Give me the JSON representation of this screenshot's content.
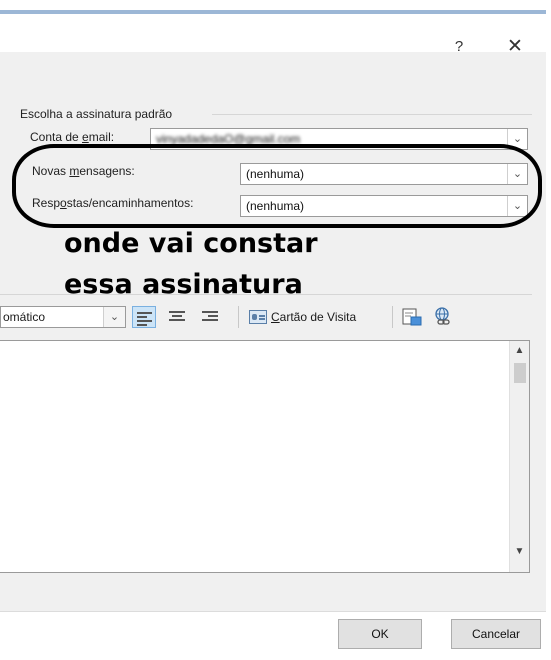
{
  "window": {
    "help_label": "?",
    "close_label": "✕"
  },
  "signature_defaults": {
    "group_title": "Escolha a assinatura padrão",
    "email_account": {
      "label_prefix": "Conta de ",
      "label_underlined": "e",
      "label_suffix": "mail:",
      "value": "vinyadadedaO@gmail.com"
    },
    "new_messages": {
      "label_prefix": "Novas ",
      "label_underlined": "m",
      "label_suffix": "ensagens:",
      "value": "(nenhuma)"
    },
    "replies_forwards": {
      "label_prefix": "Resp",
      "label_underlined": "o",
      "label_suffix": "stas/encaminhamentos:",
      "value": "(nenhuma)"
    }
  },
  "annotation": {
    "line1": "onde vai constar",
    "line2": "essa assinatura"
  },
  "toolbar": {
    "font_color_value": "omático",
    "business_card_underlined": "C",
    "business_card_rest": "artão de Visita"
  },
  "dialog_buttons": {
    "ok_label": "OK",
    "cancel_label": "Cancelar"
  },
  "colors": {
    "active_align": "#cce4f7",
    "panel_bg": "#f0f0f0",
    "title_accent": "#9cb7d6"
  }
}
